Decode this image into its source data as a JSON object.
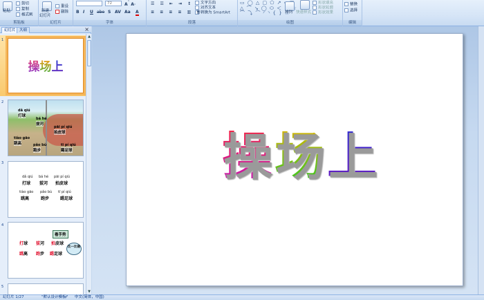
{
  "ribbon": {
    "clipboard": {
      "label": "剪贴板",
      "paste": "粘贴",
      "cut": "剪切",
      "copy": "复制",
      "format_painter": "格式刷"
    },
    "slides": {
      "label": "幻灯片",
      "new_slide": "新建",
      "new_slide2": "幻灯片",
      "reset": "重设",
      "delete": "删除"
    },
    "font": {
      "label": "字体",
      "font_name": "",
      "font_size": "72",
      "bold": "B",
      "italic": "I",
      "underline": "U",
      "strike": "abe",
      "shadow": "S",
      "spacing": "AV",
      "case": "Aa",
      "color": "A"
    },
    "paragraph": {
      "label": "段落",
      "text_direction": "文字方向",
      "align_text": "对齐文本",
      "smartart": "转换为 SmartArt"
    },
    "drawing": {
      "label": "绘图",
      "arrange": "排列",
      "quick_styles": "快速样式",
      "shape_fill": "形状填充",
      "shape_outline": "形状轮廓",
      "shape_effects": "形状效果",
      "shapes_row1": "▭ ◯ △ ▢ ⬠ ↗ ⤷ ▦",
      "shapes_row2": "△ ⌒ ↘ ◯ ⬭ ＜ ＞ ☆",
      "shapes_row3": "⌒ ⤵ ⌒ ◜ ◝ { } ☆"
    },
    "editing": {
      "label": "编辑",
      "replace": "替换",
      "select": "选择"
    }
  },
  "panel": {
    "tab_slides": "幻灯片",
    "tab_outline": "大纲",
    "close": "×"
  },
  "thumbs": {
    "t1": {
      "num": "1",
      "title": "操场上"
    },
    "t2": {
      "num": "2",
      "py": [
        "dǎ qiú",
        "bá hé",
        "pāi pí qiú",
        "tiào gāo",
        "pǎo bù",
        "tī pí qiú"
      ],
      "hz": [
        "打球",
        "拔河",
        "拍皮球",
        "跳高",
        "跑步",
        "踢足球"
      ]
    },
    "t3": {
      "num": "3",
      "py": [
        "dǎ qiú",
        "bá hé",
        "pāi pí qiú",
        "tiào gāo",
        "pǎo bù",
        "tī pí qiú"
      ],
      "hz": [
        "打球",
        "拔河",
        "拍皮球",
        "跳高",
        "跑步",
        "踢足球"
      ]
    },
    "t4": {
      "num": "4",
      "tag": "看手势",
      "bubble": "比一比做",
      "items": [
        {
          "red": "打",
          "rest": "球"
        },
        {
          "red": "拔",
          "rest": "河"
        },
        {
          "red": "拍",
          "rest": "皮球"
        },
        {
          "red": "跳",
          "rest": "高"
        },
        {
          "red": "跑",
          "rest": "步"
        },
        {
          "red": "踢",
          "rest": "足球"
        }
      ]
    },
    "t5": {
      "num": "5"
    }
  },
  "slide": {
    "title_chars": [
      "操",
      "场",
      "上"
    ],
    "colors": {
      "c1_top": "#ff2a2a",
      "c1_mid": "#c013c0",
      "c2_top": "#ffb000",
      "c2_mid": "#27c827",
      "c3_top": "#1f2bd6",
      "c3_mid": "#6a13c0"
    }
  },
  "status": {
    "slide_info": "幻灯片 1/27",
    "theme": "\"默认设计模板\"",
    "language": "中文(简体，中国)"
  }
}
